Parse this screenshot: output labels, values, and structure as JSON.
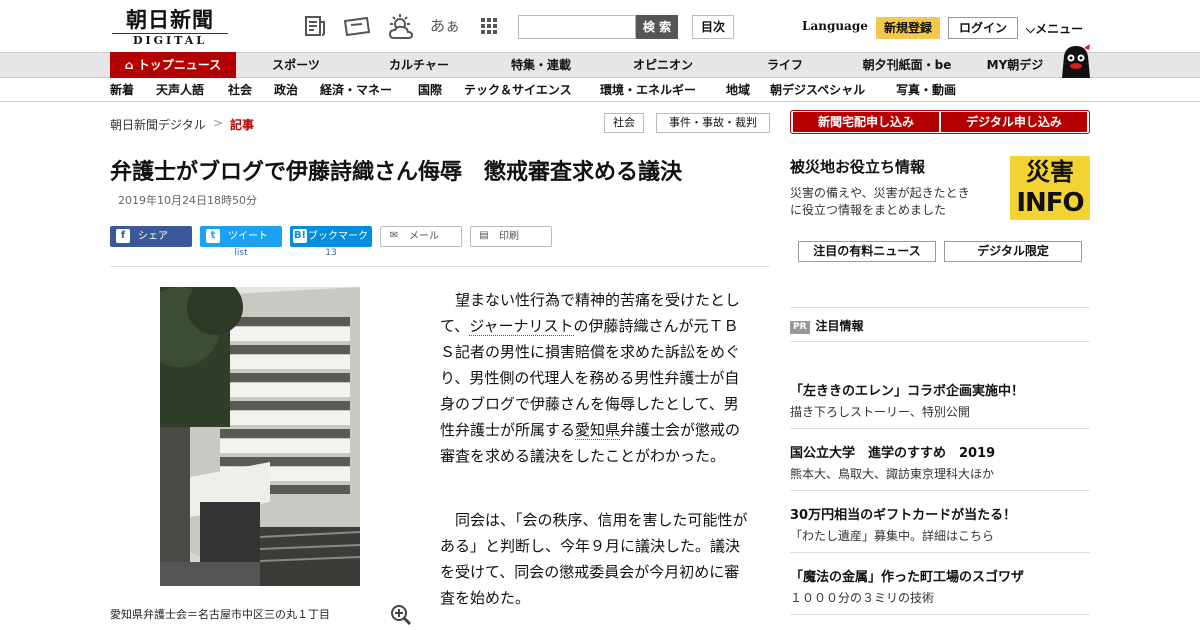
{
  "header": {
    "logo_main": "朝日新聞",
    "logo_sub": "DIGITAL",
    "font_size_label": "あぁ",
    "search_button": "検 索",
    "toc_button": "目次",
    "language": "Language",
    "register": "新規登録",
    "login": "ログイン",
    "menu": "メニュー"
  },
  "nav_main": [
    "トップニュース",
    "スポーツ",
    "カルチャー",
    "特集・連載",
    "オピニオン",
    "ライフ",
    "朝夕刊紙面・be",
    "MY朝デジ"
  ],
  "nav_sub": [
    "新着",
    "天声人語",
    "社会",
    "政治",
    "経済・マネー",
    "国際",
    "テック＆サイエンス",
    "環境・エネルギー",
    "地域",
    "朝デジスペシャル",
    "写真・動画"
  ],
  "breadcrumb": {
    "home": "朝日新聞デジタル",
    "sep": ">",
    "current": "記事"
  },
  "tags": [
    "社会",
    "事件・事故・裁判"
  ],
  "article": {
    "title": "弁護士がブログで伊藤詩織さん侮辱　懲戒審査求める議決",
    "date": "2019年10月24日18時50分",
    "share": {
      "facebook": "シェア",
      "twitter": "ツイート",
      "twitter_count": "list",
      "hatena": "ブックマーク",
      "hatena_count": "13",
      "mail": "メール",
      "print": "印刷"
    },
    "caption": "愛知県弁護士会＝名古屋市中区三の丸１丁目",
    "p1_a": "望まない性行為で精神的苦痛を受けたとして、",
    "p1_link1": "ジャーナリスト",
    "p1_b": "の伊藤詩織さんが元ＴＢＳ記者の男性に損害賠償を求めた訴訟をめぐり、男性側の代理人を務める男性弁護士が自身のブログで伊藤さんを侮辱したとして、男性弁護士が所属する",
    "p1_link2": "愛知県",
    "p1_c": "弁護士会が懲戒の審査を求める議決をしたことがわかった。",
    "p2": "同会は、「会の秩序、信用を害した可能性がある」と判断し、今年９月に議決した。議決を受けて、同会の懲戒委員会が今月初めに審査を始めた。"
  },
  "sidebar": {
    "buttons": [
      "新聞宅配申し込み",
      "デジタル申し込み"
    ],
    "disaster": {
      "heading": "被災地お役立ち情報",
      "text_1": "災害の備えや、災害が起きたとき",
      "text_2": "に役立つ情報をまとめました",
      "banner_top": "災害",
      "banner_bottom": "INFO"
    },
    "paid_buttons": [
      "注目の有料ニュース",
      "デジタル限定"
    ],
    "pr_badge": "PR",
    "pr_title": "注目情報",
    "promos": [
      {
        "title": "「左ききのエレン」コラボ企画実施中！",
        "sub": "描き下ろしストーリー、特別公開"
      },
      {
        "title": "国公立大学　進学のすすめ　2019",
        "sub": "熊本大、鳥取大、諏訪東京理科大ほか"
      },
      {
        "title": "30万円相当のギフトカードが当たる！",
        "sub": "「わたし遺産」募集中。詳細はこちら"
      },
      {
        "title": "「魔法の金属」作った町工場のスゴワザ",
        "sub": "１０００分の３ミリの技術"
      }
    ]
  },
  "colors": {
    "brand_red": "#b40000",
    "register_yellow": "#f2c94c",
    "facebook": "#3b5998",
    "twitter": "#1da1f2",
    "hatena": "#008fde"
  }
}
